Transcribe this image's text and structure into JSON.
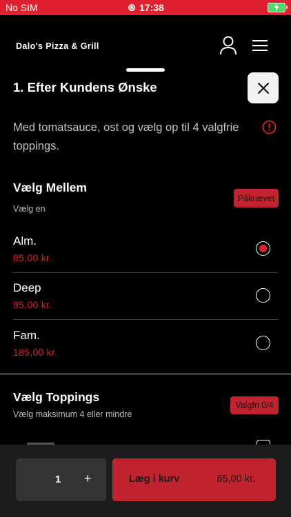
{
  "status_bar": {
    "carrier": "No SIM",
    "time": "17:38"
  },
  "header": {
    "brand": "Dalo's Pizza & Grill"
  },
  "item": {
    "title": "1. Efter Kundens Ønske",
    "description": "Med tomatsauce, ost og vælg op til 4 valgfrie toppings."
  },
  "size_group": {
    "title": "Vælg Mellem",
    "subtitle": "Vælg en",
    "badge": "Påkrævet",
    "options": [
      {
        "name": "Alm.",
        "price": "85,00 kr.",
        "selected": true
      },
      {
        "name": "Deep",
        "price": "95,00 kr.",
        "selected": false
      },
      {
        "name": "Fam.",
        "price": "185,00 kr.",
        "selected": false
      }
    ]
  },
  "toppings_group": {
    "title": "Vælg Toppings",
    "subtitle": "Vælg maksimum 4 eller mindre",
    "badge": "Valgfri 0/4"
  },
  "bottom": {
    "quantity": "1",
    "plus_label": "+",
    "add_label": "Læg i kurv",
    "total": "85,00 kr."
  },
  "colors": {
    "accent": "#e0202e",
    "badge": "#c1232f",
    "background": "#000000"
  }
}
